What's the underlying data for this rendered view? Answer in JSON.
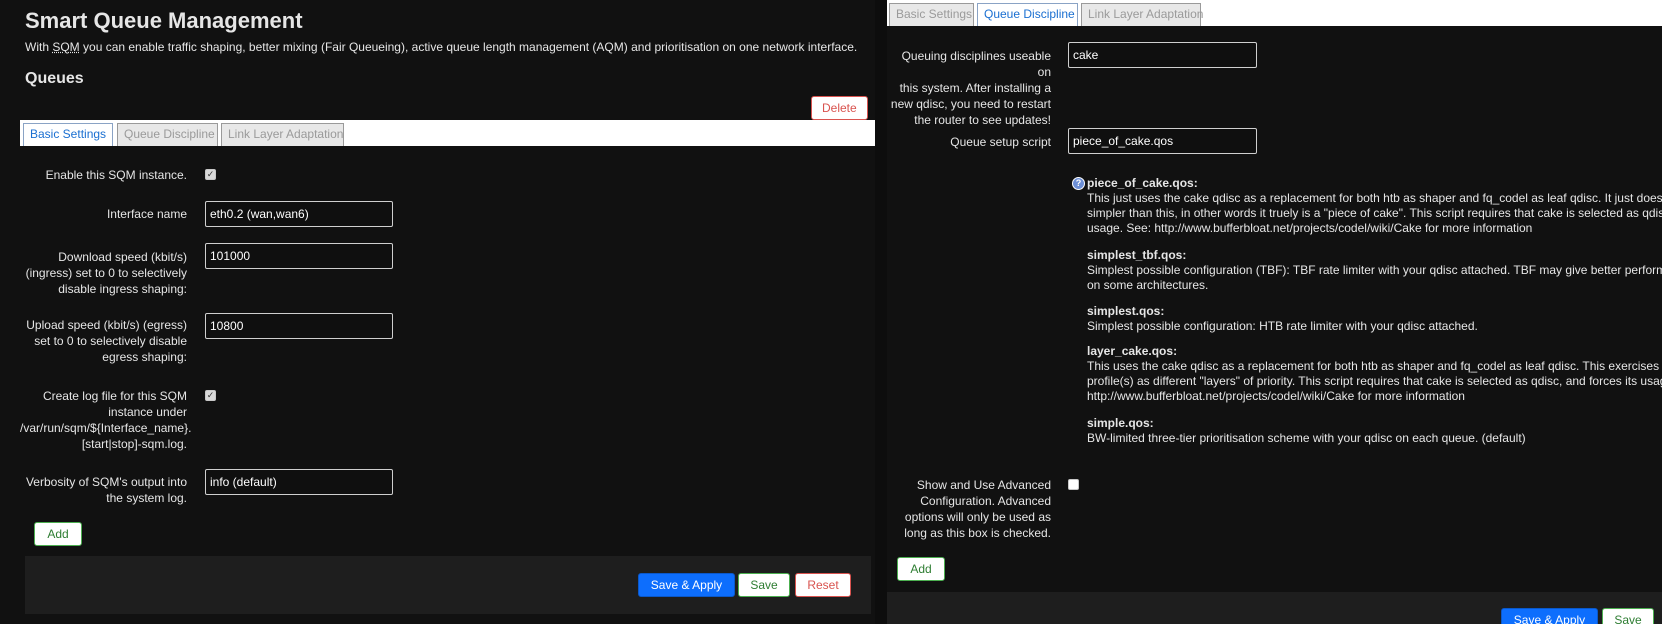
{
  "page": {
    "title": "Smart Queue Management",
    "description_pre": "With ",
    "description_abbr": "SQM",
    "description_post": " you can enable traffic shaping, better mixing (Fair Queueing), active queue length management (AQM) and prioritisation on one network interface.",
    "section_title": "Queues"
  },
  "tabs": {
    "basic": "Basic Settings",
    "qdisc": "Queue Discipline",
    "linklayer": "Link Layer Adaptation"
  },
  "left": {
    "delete_label": "Delete",
    "enable_label": "Enable this SQM instance.",
    "interface_label": "Interface name",
    "interface_value": "eth0.2 (wan,wan6)",
    "download_label_1": "Download speed (kbit/s)",
    "download_label_2": "(ingress) set to 0 to selectively",
    "download_label_3": "disable ingress shaping:",
    "download_value": "101000",
    "upload_label_1": "Upload speed (kbit/s) (egress)",
    "upload_label_2": "set to 0 to selectively disable",
    "upload_label_3": "egress shaping:",
    "upload_value": "10800",
    "log_label_1": "Create log file for this SQM",
    "log_label_2": "instance under",
    "log_label_3": "/var/run/sqm/${Interface_name}.",
    "log_label_4": "[start|stop]-sqm.log.",
    "verbosity_label_1": "Verbosity of SQM's output into",
    "verbosity_label_2": "the system log.",
    "verbosity_value": "info (default)",
    "add_label": "Add",
    "save_apply_label": "Save & Apply",
    "save_label": "Save",
    "reset_label": "Reset"
  },
  "right": {
    "qdisc_label_1": "Queuing disciplines useable on",
    "qdisc_label_2": "this system. After installing a",
    "qdisc_label_3": "new qdisc, you need to restart",
    "qdisc_label_4": "the router to see updates!",
    "qdisc_value": "cake",
    "script_label": "Queue setup script",
    "script_value": "piece_of_cake.qos",
    "help": {
      "h1": "piece_of_cake.qos:",
      "h1_l1": "This just uses the cake qdisc as a replacement for both htb as shaper and fq_codel as leaf qdisc. It just does no",
      "h1_l2": "simpler than this, in other words it truely is a \"piece of cake\". This script requires that cake is selected as qdisc,",
      "h1_l3": "usage. See: http://www.bufferbloat.net/projects/codel/wiki/Cake for more information",
      "h2": "simplest_tbf.qos:",
      "h2_l1": "Simplest possible configuration (TBF): TBF rate limiter with your qdisc attached. TBF may give better performar",
      "h2_l2": "on some architectures.",
      "h3": "simplest.qos:",
      "h3_l1": "Simplest possible configuration: HTB rate limiter with your qdisc attached.",
      "h4": "layer_cake.qos:",
      "h4_l1": "This uses the cake qdisc as a replacement for both htb as shaper and fq_codel as leaf qdisc. This exercises ca",
      "h4_l2": "profile(s) as different \"layers\" of priority. This script requires that cake is selected as qdisc, and forces its usage.",
      "h4_l3": "http://www.bufferbloat.net/projects/codel/wiki/Cake for more information",
      "h5": "simple.qos:",
      "h5_l1": "BW-limited three-tier prioritisation scheme with your qdisc on each queue. (default)"
    },
    "advanced_label_1": "Show and Use Advanced",
    "advanced_label_2": "Configuration. Advanced",
    "advanced_label_3": "options will only be used as",
    "advanced_label_4": "long as this box is checked.",
    "add_label": "Add",
    "save_apply_label": "Save & Apply",
    "save_label": "Save"
  },
  "icons": {
    "checked_glyph": "✓",
    "info_glyph": "?"
  }
}
